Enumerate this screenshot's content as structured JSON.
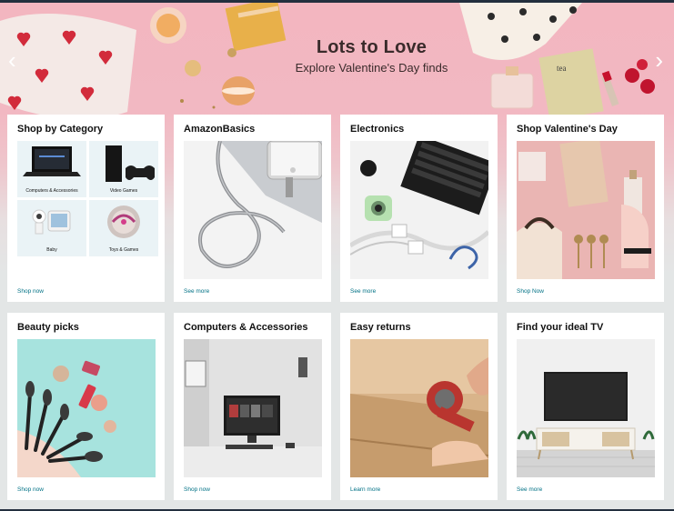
{
  "hero": {
    "title": "Lots to Love",
    "subtitle": "Explore Valentine's Day finds",
    "arrow_left": "‹",
    "arrow_right": "›"
  },
  "cards": [
    {
      "title": "Shop by Category",
      "link": "Shop now",
      "tiles": [
        {
          "label": "Computers & Accessories"
        },
        {
          "label": "Video Games"
        },
        {
          "label": "Baby"
        },
        {
          "label": "Toys & Games"
        }
      ]
    },
    {
      "title": "AmazonBasics",
      "link": "See more"
    },
    {
      "title": "Electronics",
      "link": "See more"
    },
    {
      "title": "Shop Valentine's Day",
      "link": "Shop Now"
    },
    {
      "title": "Beauty picks",
      "link": "Shop now"
    },
    {
      "title": "Computers & Accessories",
      "link": "Shop now"
    },
    {
      "title": "Easy returns",
      "link": "Learn more"
    },
    {
      "title": "Find your ideal TV",
      "link": "See more"
    }
  ],
  "colors": {
    "link": "#007185",
    "hero_pink": "#f3b6c0",
    "page_bg": "#e3e6e6"
  }
}
